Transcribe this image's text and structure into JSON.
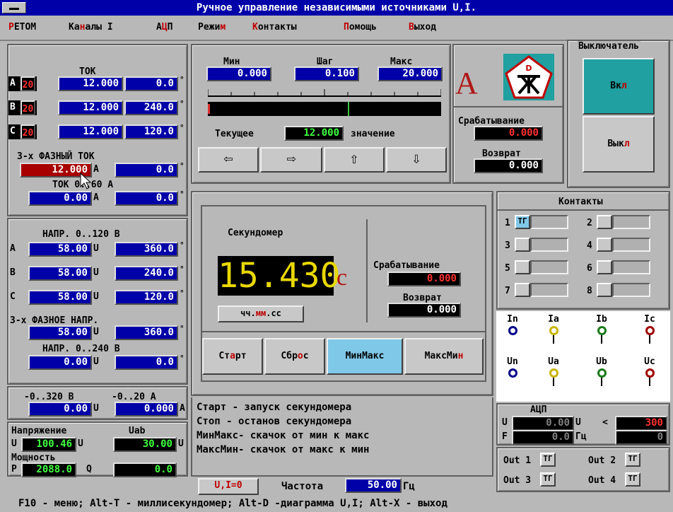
{
  "title": "Ручное управление независимыми источниками U,I.",
  "menu": {
    "items": [
      {
        "pre": "Р",
        "hl": "",
        "rest": "ЕТОМ"
      },
      {
        "pre": "Ка",
        "hl": "н",
        "rest": "алы I"
      },
      {
        "pre": "А",
        "hl": "Ц",
        "rest": "П"
      },
      {
        "pre": "Режи",
        "hl": "м",
        "rest": ""
      },
      {
        "pre": "",
        "hl": "К",
        "rest": "онтакты"
      },
      {
        "pre": "",
        "hl": "П",
        "rest": "омощь"
      },
      {
        "pre": "",
        "hl": "В",
        "rest": "ыход"
      }
    ]
  },
  "current": {
    "title": "ТОК",
    "rows": [
      {
        "phase": "A",
        "code": "20",
        "amp": "12.000",
        "angle": "0.0"
      },
      {
        "phase": "B",
        "code": "20",
        "amp": "12.000",
        "angle": "240.0"
      },
      {
        "phase": "C",
        "code": "20",
        "amp": "12.000",
        "angle": "120.0"
      }
    ],
    "three_phase_label": "3-х ФАЗНЫЙ   ТОК",
    "three_phase_amp": "12.000",
    "three_phase_unit": "А",
    "three_phase_angle": "0.0",
    "range_label": "ТОК     0..60 А",
    "range_amp": "0.00",
    "range_unit": "А",
    "range_angle": "0.0"
  },
  "voltage": {
    "title": "НАПР.   0..120 В",
    "rows": [
      {
        "phase": "A",
        "val": "58.00",
        "unit": "U",
        "angle": "360.0"
      },
      {
        "phase": "B",
        "val": "58.00",
        "unit": "U",
        "angle": "240.0"
      },
      {
        "phase": "C",
        "val": "58.00",
        "unit": "U",
        "angle": "120.0"
      }
    ],
    "three_phase_label": "3-х ФАЗНОЕ   НАПР.",
    "three_phase_val": "58.00",
    "three_phase_angle": "360.0",
    "range_label": "НАПР.   0..240 В",
    "range_val": "0.00",
    "range_angle": "0.0"
  },
  "dc": {
    "label1": "-0..320 В",
    "label2": "-0..20 А",
    "v": "0.00",
    "v_unit": "U",
    "a": "0.000",
    "a_unit": "А"
  },
  "measure": {
    "voltage_label": "Напряжение",
    "uab_label": "Uab",
    "u_prefix": "U",
    "u_val": "100.46",
    "u_unit": "U",
    "uab_val": "30.00",
    "power_label": "Мощность",
    "p_prefix": "P",
    "p_val": "2088.0",
    "q_prefix": "Q",
    "q_val": "0.0"
  },
  "ramp": {
    "min_label": "Мин",
    "step_label": "Шаг",
    "max_label": "Макс",
    "min": "0.000",
    "step": "0.100",
    "max": "20.000",
    "current_label": "Текущее",
    "current_val": "12.000",
    "current_suffix": "значение",
    "progress": 0.6
  },
  "indicator": {
    "letter": "A",
    "trip_label": "Срабатывание",
    "trip_val": "0.000",
    "return_label": "Возврат",
    "return_val": "0.000"
  },
  "switch": {
    "title": "Выключатель",
    "on_pre": "Вк",
    "on_hl": "л",
    "off_pre": "Вык",
    "off_hl": "л"
  },
  "stopwatch": {
    "title": "Секундомер",
    "value": "15.430",
    "unit": "с",
    "format_pre": "чч.",
    "format_hl": "мм",
    "format_post": ".сс",
    "trip_label": "Срабатывание",
    "trip_val": "0.000",
    "return_label": "Возврат",
    "return_val": "0.000",
    "buttons": [
      {
        "pre": "Ст",
        "hl": "а",
        "rest": "рт"
      },
      {
        "pre": "Сбр",
        "hl": "о",
        "rest": "с"
      },
      {
        "pre": "МинМакс",
        "hl": "",
        "rest": ""
      },
      {
        "pre": "МаксМи",
        "hl": "н",
        "rest": ""
      }
    ]
  },
  "help": [
    "Старт  - запуск секундомера",
    "Стоп   - останов секундомера",
    "МинМакс- скачок от мин к макс",
    "МаксМин- скачок от макс к мин"
  ],
  "contacts": {
    "title": "Контакты",
    "labels": [
      "1",
      "2",
      "3",
      "4",
      "5",
      "6",
      "7",
      "8"
    ]
  },
  "terminals": {
    "top": [
      "In",
      "Ia",
      "Ib",
      "Ic"
    ],
    "bottom": [
      "Un",
      "Ua",
      "Ub",
      "Uc"
    ],
    "colors": [
      "#00008b",
      "#c8b400",
      "#1a7a1a",
      "#a00000"
    ]
  },
  "adc": {
    "title": "АЦП",
    "u_label": "U",
    "u_val": "0.00",
    "u_unit": "U",
    "lt": "<",
    "limit": "300",
    "f_label": "F",
    "f_val": "0.0",
    "f_unit": "Гц",
    "f2": "0"
  },
  "outs": {
    "labels": [
      "Out 1",
      "Out 2",
      "Out 3",
      "Out 4"
    ]
  },
  "bottom": {
    "ui_zero": "U,I=0",
    "freq_label": "Частота",
    "freq_val": "50.00",
    "freq_unit": "Гц"
  },
  "status": "F10 - меню; Alt-T - миллисекундомер; Alt-D -диаграмма U,I; Alt-X - выход",
  "toggle_text": "ТГ"
}
